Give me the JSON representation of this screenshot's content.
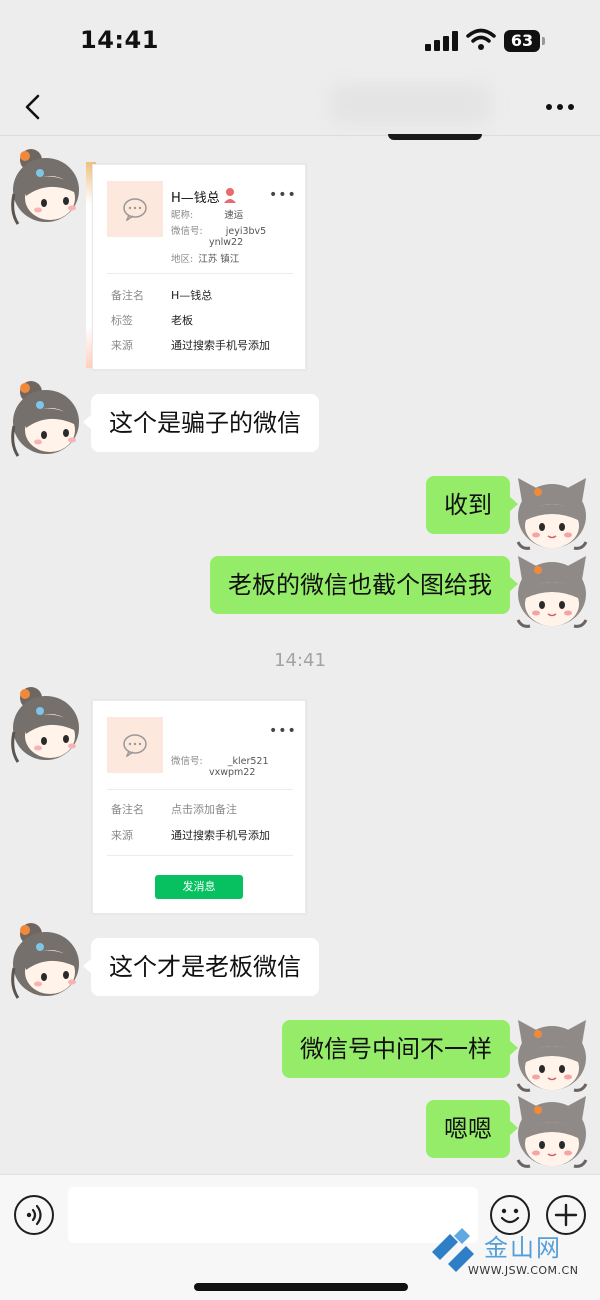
{
  "status_bar": {
    "time": "14:41",
    "battery": "63"
  },
  "nav": {
    "back_icon": "chevron-left-icon",
    "more_icon": "more-icon"
  },
  "messages": {
    "m1_text": "这个是骗子的微信",
    "m2_text": "收到",
    "m3_text": "老板的微信也截个图给我",
    "timestamp": "14:41",
    "m5_text": "这个才是老板微信",
    "m6_text": "微信号中间不一样",
    "m7_text": "嗯嗯"
  },
  "card1": {
    "name": "H—钱总",
    "dots": "•••",
    "nickname_label": "昵称:",
    "nickname_value": "速运",
    "wechat_id_label": "微信号:",
    "wechat_id_line1": "jeyi3bv5",
    "wechat_id_line2": "ynlw22",
    "region_label": "地区:",
    "region_value": "江苏 镇江",
    "remark_label": "备注名",
    "remark_value": "H—钱总",
    "tag_label": "标签",
    "tag_value": "老板",
    "source_label": "来源",
    "source_value": "通过搜索手机号添加"
  },
  "card2": {
    "dots": "•••",
    "wechat_id_label": "微信号:",
    "wechat_id_line1": "_kler521",
    "wechat_id_line2": "vxwpm22",
    "remark_label": "备注名",
    "remark_value": "点击添加备注",
    "source_label": "来源",
    "source_value": "通过搜索手机号添加",
    "send_button": "发消息"
  },
  "input_bar": {
    "voice_icon": "voice-icon",
    "emoji_icon": "emoji-icon",
    "plus_icon": "plus-icon",
    "input_value": ""
  },
  "watermark": {
    "text": "金山网",
    "url": "WWW.JSW.COM.CN"
  },
  "colors": {
    "outgoing_bubble": "#95ec69",
    "incoming_bubble": "#ffffff",
    "background": "#ededed",
    "send_button": "#07c160",
    "watermark": "#3b8fd1"
  }
}
